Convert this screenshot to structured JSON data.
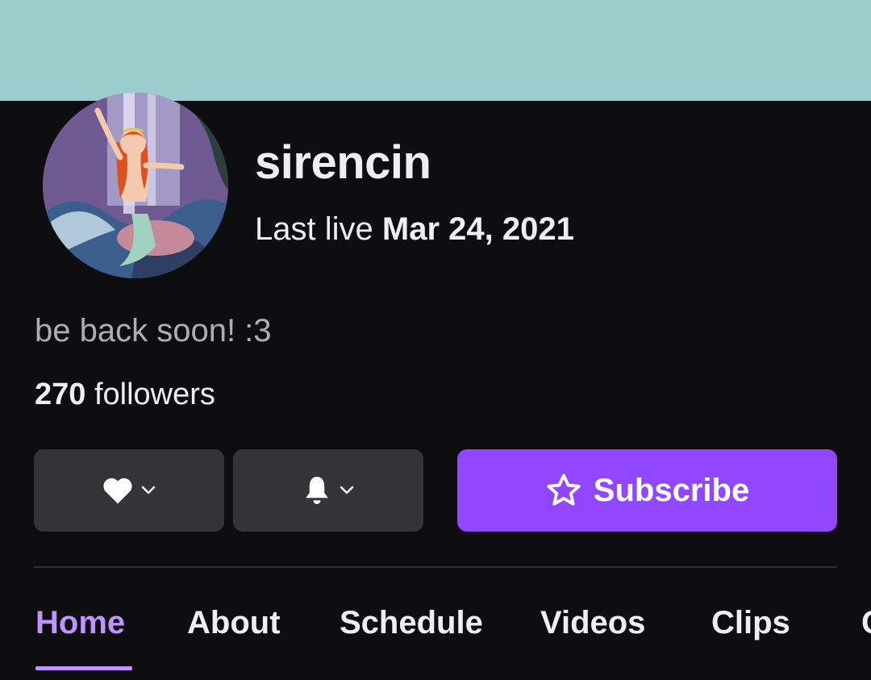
{
  "channel": {
    "name": "sirencin",
    "last_live_label": "Last live",
    "last_live_date": "Mar 24, 2021",
    "status_message": "be back soon! :3",
    "followers_count": "270",
    "followers_label": "followers"
  },
  "colors": {
    "banner": "#9dcccd",
    "background": "#0e0e10",
    "accent": "#9147ff",
    "active_tab": "#bf94ff"
  },
  "actions": {
    "follow_icon": "heart-icon",
    "notify_icon": "bell-icon",
    "subscribe_icon": "star-icon",
    "subscribe_label": "Subscribe"
  },
  "tabs": [
    {
      "label": "Home",
      "active": true
    },
    {
      "label": "About",
      "active": false
    },
    {
      "label": "Schedule",
      "active": false
    },
    {
      "label": "Videos",
      "active": false
    },
    {
      "label": "Clips",
      "active": false
    },
    {
      "label": "C",
      "active": false
    }
  ]
}
